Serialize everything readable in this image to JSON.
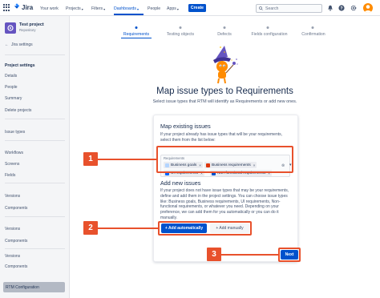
{
  "topnav": {
    "product": "Jira",
    "items": [
      {
        "label": "Your work",
        "has_caret": false
      },
      {
        "label": "Projects",
        "has_caret": true
      },
      {
        "label": "Filters",
        "has_caret": true
      },
      {
        "label": "Dashboards",
        "has_caret": true,
        "active": true
      },
      {
        "label": "People",
        "has_caret": false
      },
      {
        "label": "Apps",
        "has_caret": true
      }
    ],
    "create_label": "Create",
    "search_placeholder": "Search",
    "icons": [
      "bell-icon",
      "help-icon",
      "settings-icon"
    ]
  },
  "sidebar": {
    "project_name": "Test project",
    "project_type": "Repository",
    "jira_settings": "Jira settings",
    "section_heading": "Project settings",
    "items": [
      "Details",
      "People",
      "Summary",
      "Delete projects",
      "Issue types",
      "Workflows",
      "Screens",
      "Fields",
      "Versions",
      "Components",
      "Versions",
      "Components",
      "Versions",
      "Components"
    ],
    "selected_item": "RTM Configuration"
  },
  "steps": [
    {
      "label": "Requirements",
      "active": true
    },
    {
      "label": "Testing objects",
      "active": false
    },
    {
      "label": "Defects",
      "active": false
    },
    {
      "label": "Fields configuration",
      "active": false
    },
    {
      "label": "Confirmation",
      "active": false
    }
  ],
  "main": {
    "title": "Map issue types to Requirements",
    "subtitle": "Select issue types that RTM will identify as Requirements or add new ones."
  },
  "card": {
    "map_heading": "Map existing issues",
    "map_text": "If your project already has issue types that will be your requirements, select them from the list below:",
    "field_label": "Requirements",
    "tags": [
      {
        "label": "Business goals",
        "color": "#b3d4ff"
      },
      {
        "label": "Business requirements",
        "color": "#de350b"
      },
      {
        "label": "UI requirements",
        "color": "#0065ff"
      },
      {
        "label": "Non-functional requirements",
        "color": "#0052cc"
      }
    ],
    "add_heading": "Add new issues",
    "add_text": "If your project does not have issue types that may be your requirements, define and add them in the project settings. You can choose issue types like: Business goals, Business requirements, UI requirements, Non-functional requirements, or whatever you need. Depending on your preference, we can add them for you automatically or you can do it manually.",
    "add_auto_label": "+ Add automatically",
    "add_manual_label": "+ Add manually"
  },
  "next_label": "Next",
  "callouts": [
    "1",
    "2",
    "3"
  ],
  "colors": {
    "accent": "#0052cc",
    "callout": "#e8512c",
    "sidebar_bg": "#f4f5f7"
  }
}
